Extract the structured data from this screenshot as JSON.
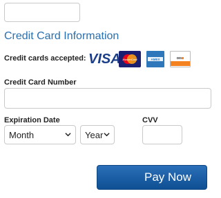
{
  "section": {
    "title": "Credit Card Information"
  },
  "cards": {
    "accepted_label": "Credit cards accepted:",
    "visa": "VISA",
    "mastercard": "MasterCard",
    "amex": "AMEX",
    "discover": "DISCOVER"
  },
  "card_number": {
    "label": "Credit Card Number",
    "value": ""
  },
  "expiration": {
    "label": "Expiration Date",
    "month_value": "Month",
    "year_value": "Year"
  },
  "cvv": {
    "label": "CVV",
    "value": ""
  },
  "pay_button": {
    "label": "Pay Now"
  },
  "colors": {
    "accent": "#2a6fb0",
    "button": "#155aa3",
    "border": "#c9c9c9"
  }
}
